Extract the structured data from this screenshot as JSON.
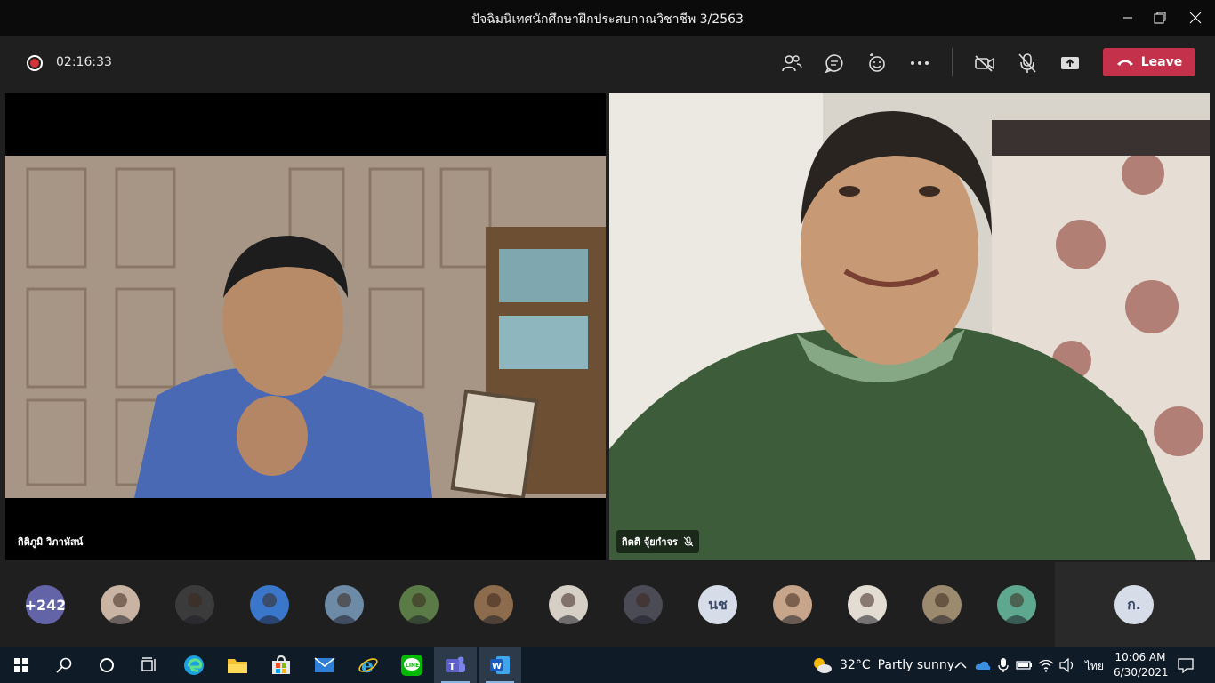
{
  "window": {
    "title": "ปัจฉิมนิเทศนักศึกษาฝึกประสบกาณวิชาชีพ 3/2563"
  },
  "toolbar": {
    "recording_time": "02:16:33",
    "leave_label": "Leave",
    "icons": [
      "participants-icon",
      "chat-icon",
      "reactions-icon",
      "more-options-icon",
      "camera-off-icon",
      "mic-off-icon",
      "share-screen-icon",
      "hang-up-icon"
    ]
  },
  "tiles": [
    {
      "name": "กิติภูมิ วิภาหัสน์",
      "muted": false
    },
    {
      "name": "กิตติ จุ้ยกำจร",
      "muted": true
    }
  ],
  "participants": {
    "overflow_count": "+242",
    "avatars": [
      {
        "kind": "photo",
        "color": "#c9b3a2"
      },
      {
        "kind": "photo",
        "color": "#3b3b3b"
      },
      {
        "kind": "photo",
        "color": "#3a76c9"
      },
      {
        "kind": "photo",
        "color": "#6d8aa6"
      },
      {
        "kind": "photo",
        "color": "#5a7a46"
      },
      {
        "kind": "photo",
        "color": "#8c6c4c"
      },
      {
        "kind": "photo",
        "color": "#d6cfc5"
      },
      {
        "kind": "photo",
        "color": "#4b4b55"
      },
      {
        "kind": "initials",
        "text": "นช",
        "color": "#d7dde8",
        "text_color": "#3b4a6b"
      },
      {
        "kind": "photo",
        "color": "#c7a58b"
      },
      {
        "kind": "photo",
        "color": "#e3dcd3"
      },
      {
        "kind": "photo",
        "color": "#9c8a6e"
      },
      {
        "kind": "photo",
        "color": "#5ea88f"
      }
    ],
    "extra_avatar": {
      "text": "ก.",
      "color": "#d7dde8",
      "text_color": "#3b4a6b"
    }
  },
  "taskbar": {
    "apps": [
      "windows-start-icon",
      "search-icon",
      "cortana-icon",
      "task-view-icon",
      "edge-icon",
      "file-explorer-icon",
      "store-icon",
      "mail-icon",
      "internet-explorer-icon",
      "line-icon",
      "teams-icon",
      "word-icon"
    ],
    "weather_temp": "32°C",
    "weather_text": "Partly sunny",
    "language": "ไทย",
    "time": "10:06 AM",
    "date": "6/30/2021",
    "colors": {
      "teams": "#5b5fc7",
      "word": "#185abd",
      "line": "#00b900",
      "edge": "#1ba1e2",
      "leave": "#c4314b"
    }
  }
}
